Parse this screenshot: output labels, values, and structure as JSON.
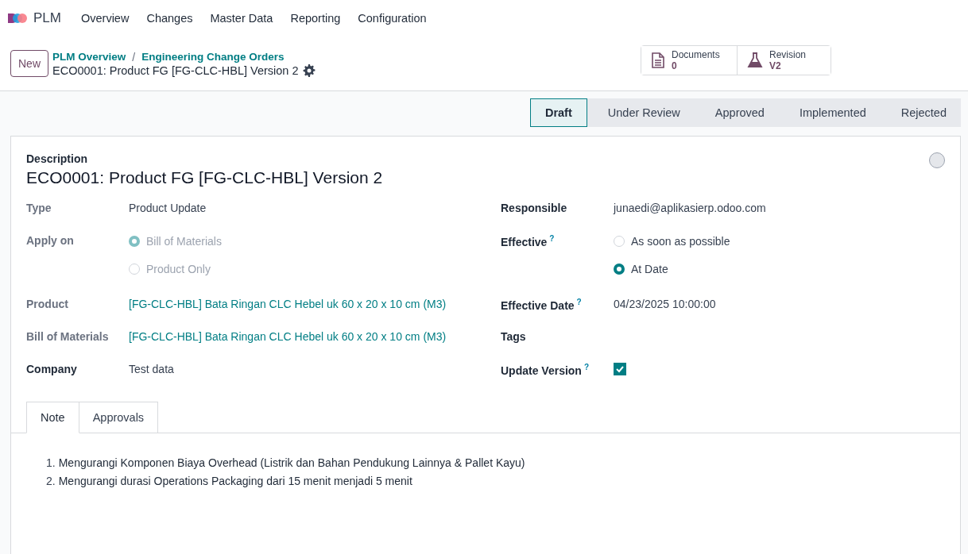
{
  "navbar": {
    "app": "PLM",
    "menus": [
      "Overview",
      "Changes",
      "Master Data",
      "Reporting",
      "Configuration"
    ]
  },
  "control_panel": {
    "new_button": "New",
    "breadcrumbs": [
      "PLM Overview",
      "Engineering Change Orders"
    ],
    "separator": "/",
    "record_title": "ECO0001: Product FG [FG-CLC-HBL] Version 2"
  },
  "smart_buttons": [
    {
      "kind": "document",
      "label": "Documents",
      "value": "0"
    },
    {
      "kind": "flask",
      "label": "Revision",
      "value": "V2"
    }
  ],
  "stages": [
    {
      "label": "Draft",
      "selected": true
    },
    {
      "label": "Under Review",
      "selected": false
    },
    {
      "label": "Approved",
      "selected": false
    },
    {
      "label": "Implemented",
      "selected": false
    },
    {
      "label": "Rejected",
      "selected": false
    }
  ],
  "sheet": {
    "description_label": "Description",
    "title": "ECO0001: Product FG [FG-CLC-HBL] Version 2",
    "priority_on": false,
    "left_fields": [
      {
        "kind": "text",
        "label": "Type",
        "readonly": true,
        "value": "Product Update"
      },
      {
        "kind": "radio",
        "label": "Apply on",
        "readonly": true,
        "options": [
          {
            "label": "Bill of Materials",
            "selected": true
          },
          {
            "label": "Product Only",
            "selected": false
          }
        ]
      },
      {
        "kind": "link",
        "label": "Product",
        "readonly": true,
        "value": "[FG-CLC-HBL] Bata Ringan CLC Hebel uk 60 x 20 x 10 cm (M3)"
      },
      {
        "kind": "link",
        "label": "Bill of Materials",
        "readonly": true,
        "value": "[FG-CLC-HBL] Bata Ringan CLC Hebel uk 60 x 20 x 10 cm (M3)"
      },
      {
        "kind": "text",
        "label": "Company",
        "readonly": false,
        "value": "Test data"
      }
    ],
    "right_fields": [
      {
        "kind": "text",
        "label": "Responsible",
        "readonly": false,
        "value": "junaedi@aplikasierp.odoo.com"
      },
      {
        "kind": "radio",
        "label": "Effective",
        "readonly": false,
        "help": "?",
        "options": [
          {
            "label": "As soon as possible",
            "selected": false
          },
          {
            "label": "At Date",
            "selected": true
          }
        ]
      },
      {
        "kind": "text",
        "label": "Effective Date",
        "readonly": false,
        "help": "?",
        "value": "04/23/2025 10:00:00"
      },
      {
        "kind": "empty",
        "label": "Tags",
        "readonly": false
      },
      {
        "kind": "checkbox",
        "label": "Update Version",
        "readonly": false,
        "help": "?",
        "checked": true
      }
    ],
    "tabs": [
      {
        "label": "Note",
        "selected": true
      },
      {
        "label": "Approvals",
        "selected": false
      }
    ],
    "note_items": [
      "Mengurangi Komponen Biaya Overhead (Listrik dan Bahan Pendukung Lainnya & Pallet Kayu)",
      "Mengurangi durasi Operations Packaging dari 15 menit menjadi 5 menit"
    ],
    "note_numbers": [
      "1.",
      "2."
    ]
  }
}
